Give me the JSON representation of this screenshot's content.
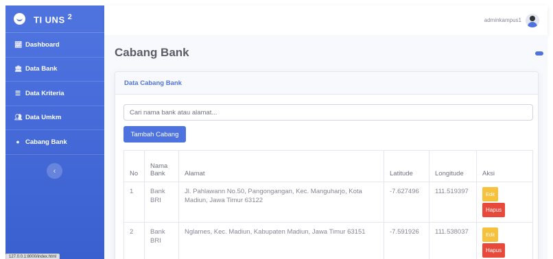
{
  "brand": {
    "title": "TI UNS",
    "superscript": "2"
  },
  "sidebar": {
    "items": [
      {
        "label": "Dashboard",
        "icon": "chart-line-icon"
      },
      {
        "label": "Data Bank",
        "icon": "bank-icon"
      },
      {
        "label": "Data Kriteria",
        "icon": "list-icon"
      },
      {
        "label": "Data Umkm",
        "icon": "users-icon"
      },
      {
        "label": "Cabang Bank",
        "icon": "map-marker-icon"
      }
    ],
    "toggle_glyph": "‹"
  },
  "status_url": "127.0.0.1:8000/index.html",
  "topbar": {
    "username": "adminkampus1"
  },
  "page": {
    "title": "Cabang Bank"
  },
  "card": {
    "header": "Data Cabang Bank",
    "search_placeholder": "Cari nama bank atau alamat...",
    "add_button": "Tambah Cabang"
  },
  "table": {
    "headers": {
      "no": "No",
      "nama_bank": "Nama Bank",
      "alamat": "Alamat",
      "latitude": "Latitude",
      "longitude": "Longitude",
      "aksi": "Aksi"
    },
    "rows": [
      {
        "no": "1",
        "nama_bank": "Bank BRI",
        "alamat": "Jl. Pahlawann No.50, Pangongangan, Kec. Manguharjo, Kota Madiun, Jawa Timur 63122",
        "latitude": "-7.627496",
        "longitude": "111.519397",
        "edit": "Edit",
        "hapus": "Hapus"
      },
      {
        "no": "2",
        "nama_bank": "Bank BRI",
        "alamat": "Nglames, Kec. Madiun, Kabupaten Madiun, Jawa Timur 63151",
        "latitude": "-7.591926",
        "longitude": "111.538037",
        "edit": "Edit",
        "hapus": "Hapus"
      }
    ]
  },
  "colors": {
    "primary": "#4e73df",
    "warning": "#f6c23e",
    "danger": "#e74a3b"
  }
}
